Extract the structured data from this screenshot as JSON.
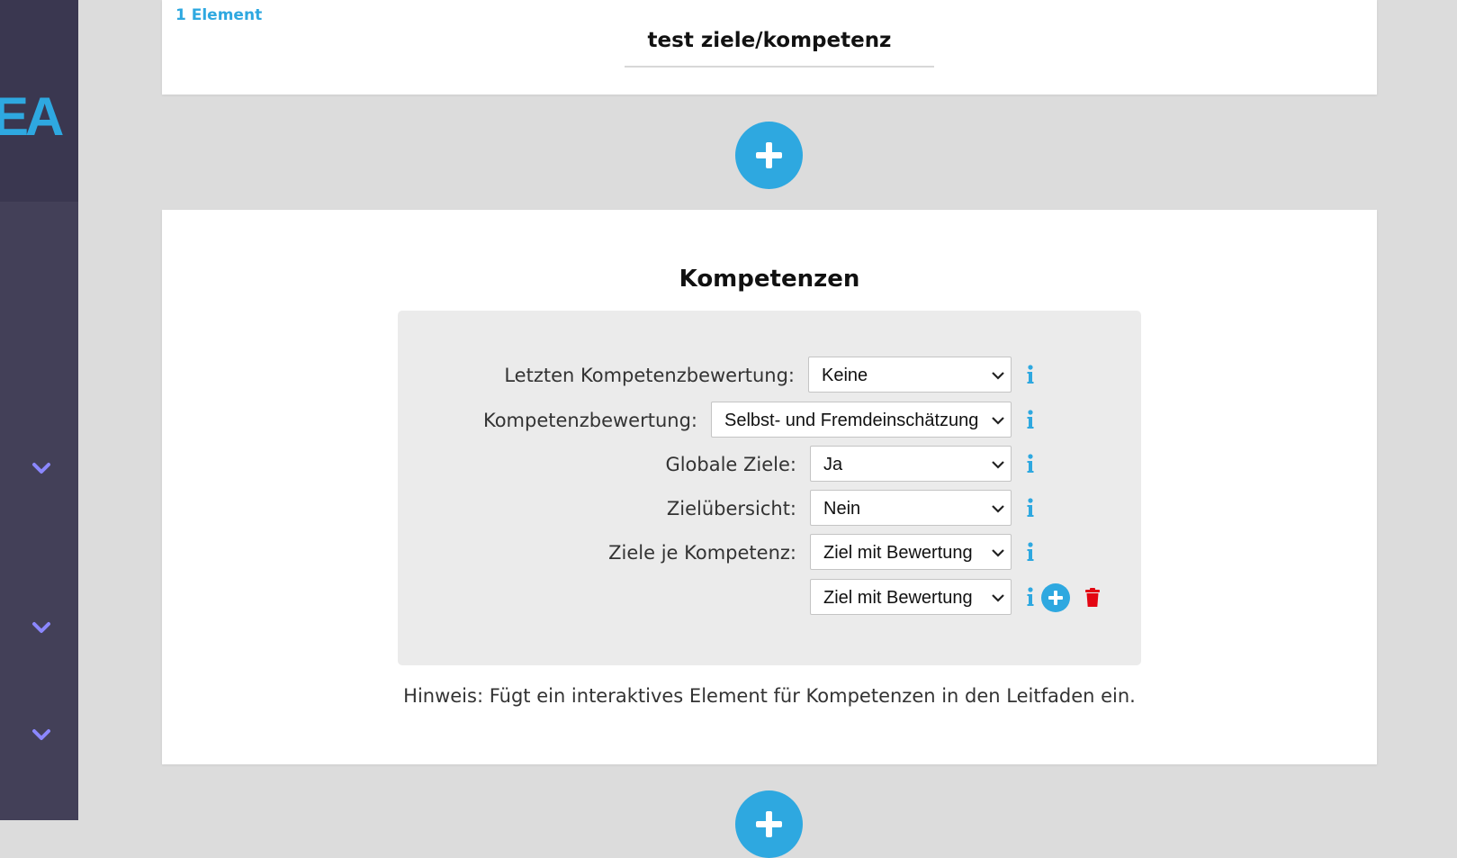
{
  "sidebar": {
    "logo_text": "EA",
    "chevrons": [
      "chevron-down-icon",
      "chevron-down-icon",
      "chevron-down-icon"
    ]
  },
  "top_card": {
    "element_count": "1 Element",
    "title": "test ziele/kompetenz"
  },
  "add_button_icon": "plus-icon",
  "section": {
    "heading": "Kompetenzen",
    "rows": [
      {
        "label": "Letzten Kompetenzbewertung:",
        "value": "Keine"
      },
      {
        "label": "Kompetenzbewertung:",
        "value": "Selbst- und Fremdeinschätzung"
      },
      {
        "label": "Globale Ziele:",
        "value": "Ja"
      },
      {
        "label": "Zielübersicht:",
        "value": "Nein"
      },
      {
        "label": "Ziele je Kompetenz:",
        "value": "Ziel mit Bewertung"
      },
      {
        "label": "",
        "value": "Ziel mit Bewertung"
      }
    ],
    "hint": "Hinweis: Fügt ein interaktives Element für Kompetenzen in den Leitfaden ein."
  },
  "colors": {
    "accent": "#2ea8e0",
    "sidebar": "#434058",
    "delete": "#e30613"
  }
}
